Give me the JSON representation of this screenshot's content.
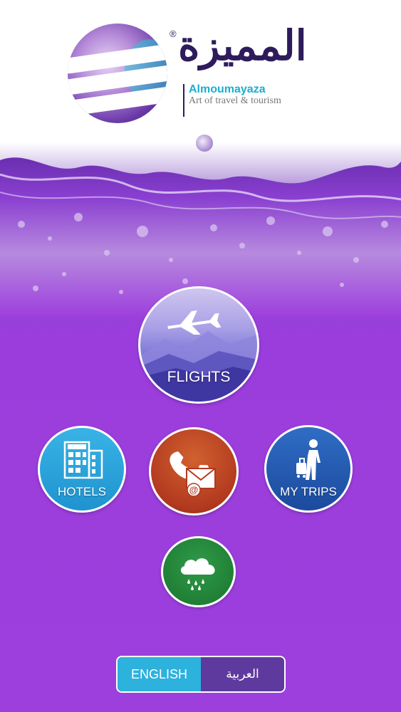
{
  "header": {
    "brand_arabic": "المميزة",
    "registered_mark": "®",
    "brand_latin": "Almoumayaza",
    "tagline": "Art of travel & tourism"
  },
  "menu": {
    "flights_label": "FLIGHTS",
    "hotels_label": "HOTELS",
    "contact_icon": "phone-envelope-icon",
    "trips_label": "MY TRIPS",
    "weather_icon": "rain-cloud-icon"
  },
  "language": {
    "english_label": "ENGLISH",
    "arabic_label": "العربية"
  },
  "colors": {
    "accent_purple": "#9d3fdd",
    "brand_dark": "#2e1b5c",
    "brand_teal": "#1aaed1",
    "flights": "#7d75d6",
    "hotels": "#1f93cf",
    "contact": "#b23a1f",
    "trips": "#1c4a9d",
    "weather": "#1e7c33"
  }
}
